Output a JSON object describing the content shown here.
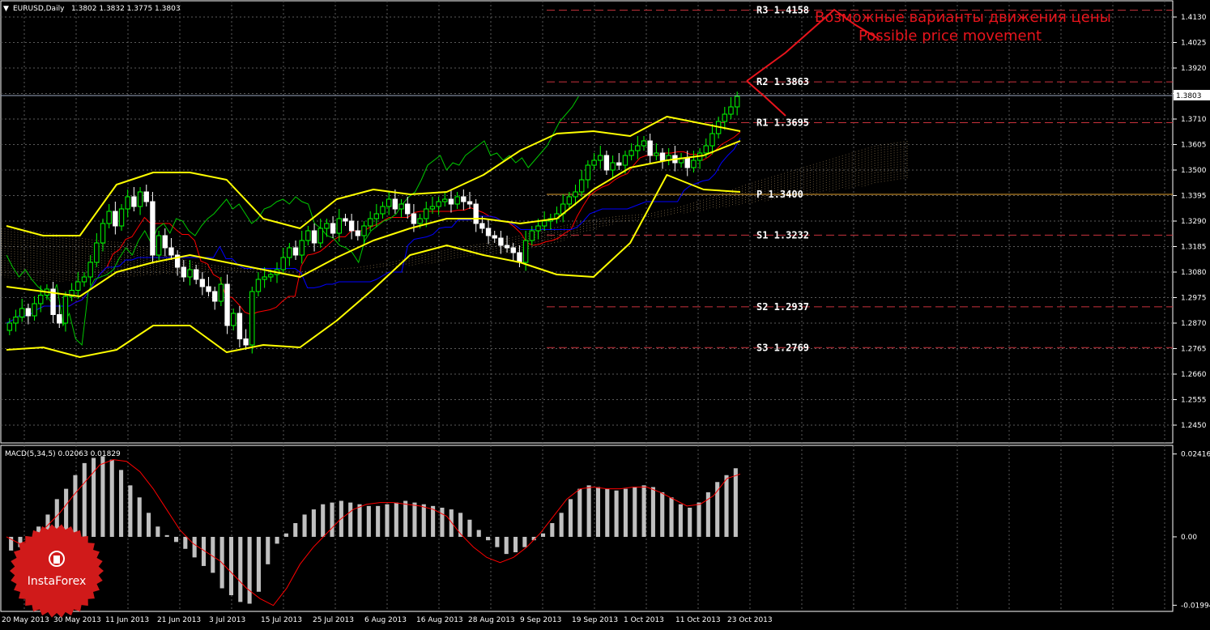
{
  "header": {
    "marker": "▼",
    "symbol_tf": "EURUSD,Daily",
    "ohlc": "1.3802 1.3832 1.3775 1.3803"
  },
  "annotation": {
    "ru": "Возможные варианты движения цены",
    "en": "Possible price movement",
    "color": "#e8141c"
  },
  "current_price_label": "1.3803",
  "price_axis": {
    "ticks": [
      "1.4130",
      "1.4025",
      "1.3920",
      "1.3815",
      "1.3710",
      "1.3605",
      "1.3500",
      "1.3395",
      "1.3290",
      "1.3185",
      "1.3080",
      "1.2975",
      "1.2870",
      "1.2765",
      "1.2660",
      "1.2555",
      "1.2450"
    ]
  },
  "macd": {
    "label": "MACD(5,34,5) 0.02063 0.01829",
    "ticks": [
      "0.02416",
      "0.00",
      "-0.01994"
    ]
  },
  "time_axis": {
    "labels": [
      "20 May 2013",
      "30 May 2013",
      "11 Jun 2013",
      "21 Jun 2013",
      "3 Jul 2013",
      "15 Jul 2013",
      "25 Jul 2013",
      "6 Aug 2013",
      "16 Aug 2013",
      "28 Aug 2013",
      "9 Sep 2013",
      "19 Sep 2013",
      "1 Oct 2013",
      "11 Oct 2013",
      "23 Oct 2013"
    ]
  },
  "pivots": [
    {
      "label": "R3  1.4158",
      "value": 1.4158
    },
    {
      "label": "R2  1.3863",
      "value": 1.3863
    },
    {
      "label": "R1  1.3695",
      "value": 1.3695
    },
    {
      "label": "P  1.3400",
      "value": 1.34
    },
    {
      "label": "S1  1.3232",
      "value": 1.3232
    },
    {
      "label": "S2  1.2937",
      "value": 1.2937
    },
    {
      "label": "S3  1.2769",
      "value": 1.2769
    }
  ],
  "logo": {
    "text": "InstaForex",
    "color": "#d01a1a"
  },
  "colors": {
    "background": "#000000",
    "grid": "#5a5a5a",
    "bull_candle": "#00ff00",
    "bear_candle": "#ffffff",
    "bollinger": "#ffff00",
    "tenkan": "#ff0000",
    "kijun": "#0000ff",
    "chikou": "#00c800",
    "cloud": "#e8c080",
    "pivot_line": "#c8323c",
    "macd_hist": "#c0c0c0",
    "macd_signal": "#ff0000"
  },
  "chart_data": {
    "type": "candlestick",
    "symbol": "EURUSD",
    "timeframe": "Daily",
    "ylim": [
      1.238,
      1.419
    ],
    "macd_ylim": [
      -0.0215,
      0.0262
    ],
    "dates": [
      "20 May 2013",
      "30 May 2013",
      "11 Jun 2013",
      "21 Jun 2013",
      "3 Jul 2013",
      "15 Jul 2013",
      "25 Jul 2013",
      "6 Aug 2013",
      "16 Aug 2013",
      "28 Aug 2013",
      "9 Sep 2013",
      "19 Sep 2013",
      "1 Oct 2013",
      "11 Oct 2013",
      "23 Oct 2013"
    ],
    "close": [
      1.287,
      1.2895,
      1.293,
      1.29,
      1.295,
      1.2985,
      1.301,
      1.2905,
      1.287,
      1.298,
      1.3005,
      1.304,
      1.306,
      1.312,
      1.32,
      1.328,
      1.333,
      1.327,
      1.334,
      1.339,
      1.335,
      1.341,
      1.337,
      1.315,
      1.323,
      1.318,
      1.315,
      1.31,
      1.306,
      1.309,
      1.305,
      1.302,
      1.3,
      1.296,
      1.303,
      1.286,
      1.291,
      1.2805,
      1.278,
      1.3,
      1.305,
      1.306,
      1.307,
      1.309,
      1.314,
      1.318,
      1.315,
      1.321,
      1.325,
      1.32,
      1.326,
      1.328,
      1.324,
      1.33,
      1.329,
      1.325,
      1.323,
      1.327,
      1.33,
      1.332,
      1.335,
      1.338,
      1.334,
      1.336,
      1.332,
      1.328,
      1.33,
      1.334,
      1.335,
      1.337,
      1.338,
      1.336,
      1.339,
      1.337,
      1.336,
      1.328,
      1.326,
      1.323,
      1.322,
      1.319,
      1.318,
      1.316,
      1.312,
      1.321,
      1.325,
      1.327,
      1.329,
      1.33,
      1.332,
      1.336,
      1.339,
      1.341,
      1.346,
      1.352,
      1.354,
      1.356,
      1.35,
      1.353,
      1.352,
      1.356,
      1.358,
      1.36,
      1.362,
      1.356,
      1.357,
      1.354,
      1.356,
      1.353,
      1.355,
      1.351,
      1.354,
      1.357,
      1.36,
      1.365,
      1.37,
      1.373,
      1.376,
      1.3803
    ],
    "bollinger": {
      "upper": [
        1.327,
        1.323,
        1.323,
        1.344,
        1.349,
        1.349,
        1.346,
        1.33,
        1.326,
        1.338,
        1.342,
        1.34,
        1.341,
        1.348,
        1.358,
        1.365,
        1.366,
        1.364,
        1.372,
        1.369,
        1.366
      ],
      "middle": [
        1.302,
        1.3,
        1.298,
        1.308,
        1.312,
        1.315,
        1.312,
        1.309,
        1.306,
        1.314,
        1.321,
        1.326,
        1.33,
        1.33,
        1.328,
        1.33,
        1.342,
        1.351,
        1.354,
        1.356,
        1.362
      ],
      "lower": [
        1.276,
        1.277,
        1.273,
        1.276,
        1.286,
        1.286,
        1.275,
        1.278,
        1.277,
        1.288,
        1.301,
        1.315,
        1.319,
        1.315,
        1.312,
        1.307,
        1.306,
        1.32,
        1.348,
        1.342,
        1.341
      ]
    },
    "pivot_levels": {
      "R3": 1.4158,
      "R2": 1.3863,
      "R1": 1.3695,
      "P": 1.34,
      "S1": 1.3232,
      "S2": 1.2937,
      "S3": 1.2769
    },
    "macd_histogram": [
      -0.004,
      -0.003,
      -0.001,
      0.003,
      0.0065,
      0.011,
      0.014,
      0.018,
      0.0215,
      0.023,
      0.0235,
      0.0225,
      0.0195,
      0.015,
      0.0115,
      0.007,
      0.003,
      0.0005,
      -0.0015,
      -0.0035,
      -0.006,
      -0.0085,
      -0.0105,
      -0.015,
      -0.017,
      -0.019,
      -0.0195,
      -0.016,
      -0.008,
      -0.002,
      0.001,
      0.004,
      0.0065,
      0.008,
      0.0095,
      0.01,
      0.0105,
      0.01,
      0.0095,
      0.009,
      0.009,
      0.0095,
      0.01,
      0.0105,
      0.01,
      0.0095,
      0.009,
      0.0085,
      0.008,
      0.007,
      0.005,
      0.002,
      -0.001,
      -0.003,
      -0.005,
      -0.0045,
      -0.003,
      -0.001,
      0.001,
      0.004,
      0.007,
      0.011,
      0.014,
      0.015,
      0.0145,
      0.014,
      0.0135,
      0.014,
      0.0145,
      0.015,
      0.0145,
      0.013,
      0.0115,
      0.0095,
      0.0085,
      0.01,
      0.013,
      0.016,
      0.018,
      0.02
    ],
    "macd_signal": [
      0.0,
      -0.002,
      -0.0005,
      0.003,
      0.007,
      0.012,
      0.0165,
      0.021,
      0.0225,
      0.022,
      0.019,
      0.014,
      0.008,
      0.002,
      -0.002,
      -0.0045,
      -0.007,
      -0.011,
      -0.015,
      -0.018,
      -0.02,
      -0.015,
      -0.008,
      -0.003,
      0.001,
      0.005,
      0.008,
      0.0095,
      0.01,
      0.01,
      0.0095,
      0.009,
      0.008,
      0.006,
      0.001,
      -0.003,
      -0.006,
      -0.0075,
      -0.006,
      -0.003,
      0.001,
      0.006,
      0.011,
      0.014,
      0.0145,
      0.014,
      0.014,
      0.0145,
      0.0145,
      0.013,
      0.011,
      0.009,
      0.0095,
      0.012,
      0.017,
      0.0183
    ]
  }
}
